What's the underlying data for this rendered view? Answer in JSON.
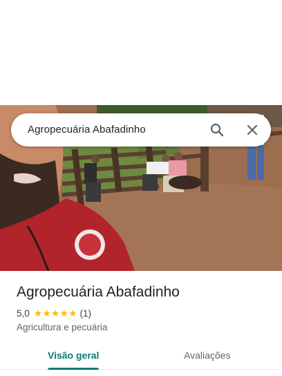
{
  "search": {
    "query": "Agropecuária Abafadinho"
  },
  "place": {
    "name": "Agropecuária Abafadinho",
    "rating": "5,0",
    "stars": "★★★★★",
    "review_count": "(1)",
    "category": "Agricultura e pecuária"
  },
  "tabs": [
    {
      "label": "Visão geral",
      "active": true
    },
    {
      "label": "Avaliações",
      "active": false
    }
  ],
  "colors": {
    "accent": "#0b7a7a",
    "star": "#fbbc04"
  },
  "icons": [
    "search-icon",
    "close-icon"
  ]
}
